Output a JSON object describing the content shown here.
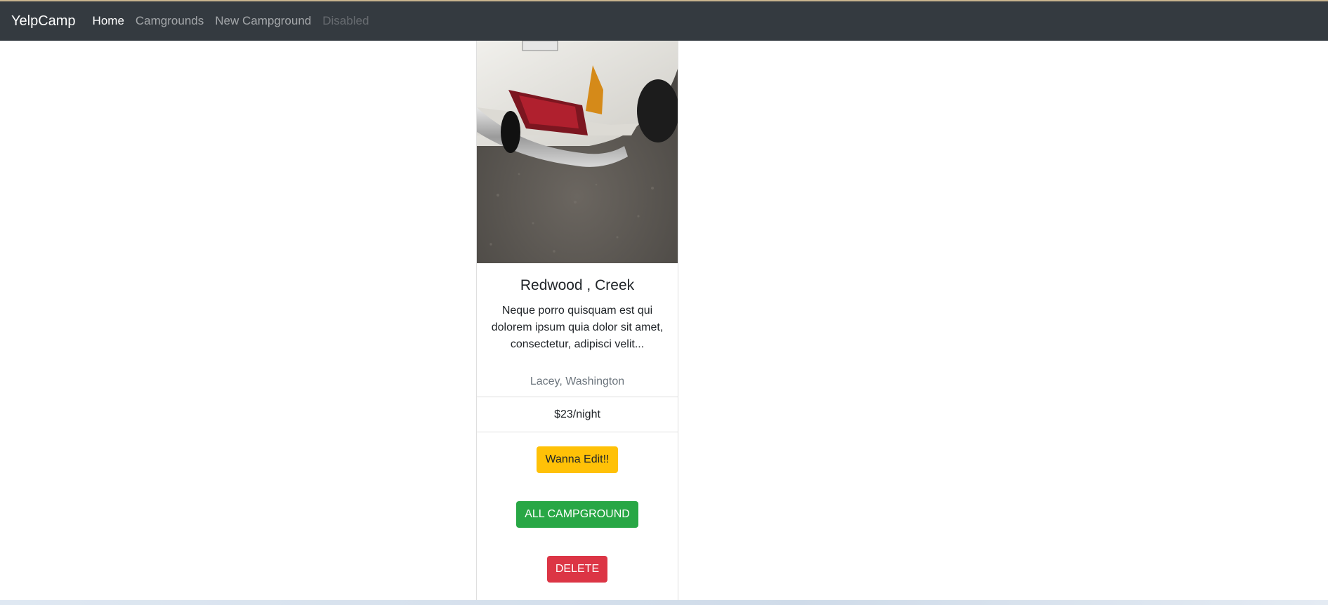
{
  "navbar": {
    "brand": "YelpCamp",
    "links": [
      {
        "label": "Home",
        "state": "active"
      },
      {
        "label": "Camgrounds",
        "state": "normal"
      },
      {
        "label": "New Campground",
        "state": "normal"
      },
      {
        "label": "Disabled",
        "state": "disabled"
      }
    ]
  },
  "card": {
    "image": {
      "icon": "campground-photo"
    },
    "title": "Redwood , Creek",
    "description": "Neque porro quisquam est qui dolorem ipsum quia dolor sit amet, consectetur, adipisci velit...",
    "location": "Lacey, Washington",
    "price": "$23/night",
    "buttons": {
      "edit": "Wanna Edit!!",
      "all": "ALL CAMPGROUND",
      "delete": "DELETE"
    }
  },
  "colors": {
    "navbar_bg": "#343a40",
    "warning": "#ffc107",
    "success": "#28a745",
    "danger": "#dc3545"
  }
}
